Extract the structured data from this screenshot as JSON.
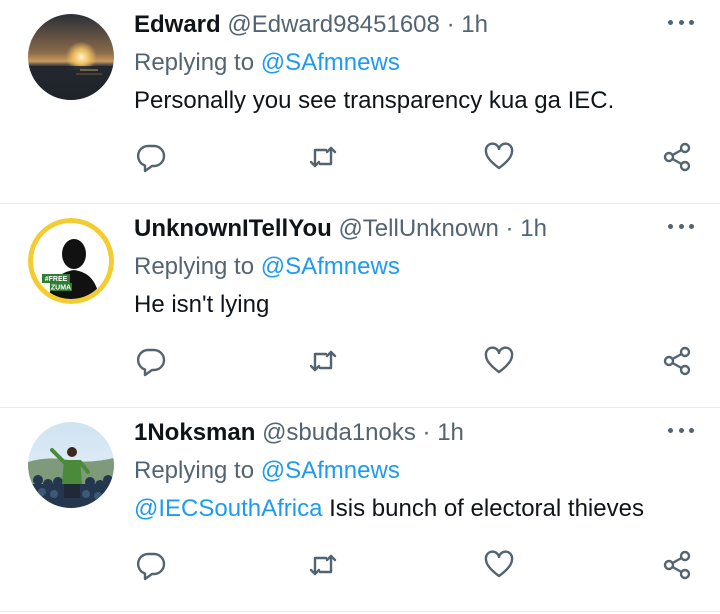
{
  "tweets": [
    {
      "name": "Edward",
      "handle": "@Edward98451608",
      "dot": "·",
      "time": "1h",
      "reply_prefix": "Replying to ",
      "reply_to": "@SAfmnews",
      "text_mention": "",
      "text": "Personally you see transparency kua ga IEC.",
      "avatar": "sunset-ocean-avatar"
    },
    {
      "name": "UnknownITellYou",
      "handle": "@TellUnknown",
      "dot": "·",
      "time": "1h",
      "reply_prefix": "Replying to ",
      "reply_to": "@SAfmnews",
      "text_mention": "",
      "text": "He isn't lying",
      "avatar": "silhouette-free-zuma-avatar",
      "avatar_badge_line1": "#FREE",
      "avatar_badge_line2": "ZUMA"
    },
    {
      "name": "1Noksman",
      "handle": "@sbuda1noks",
      "dot": "·",
      "time": "1h",
      "reply_prefix": "Replying to ",
      "reply_to": "@SAfmnews",
      "text_mention": "@IECSouthAfrica",
      "text": " Isis bunch of electoral thieves",
      "avatar": "crowd-rally-avatar"
    }
  ],
  "icons": {
    "more": "more-horizontal-icon",
    "reply": "reply-bubble-icon",
    "retweet": "retweet-icon",
    "like": "heart-icon",
    "share": "share-icon"
  },
  "colors": {
    "text": "#0f1419",
    "secondary": "#536471",
    "link": "#1d9bf0",
    "divider": "#e6ecf0",
    "free_zuma_ring": "#f2cc30",
    "badge_green": "#2e7d32"
  }
}
